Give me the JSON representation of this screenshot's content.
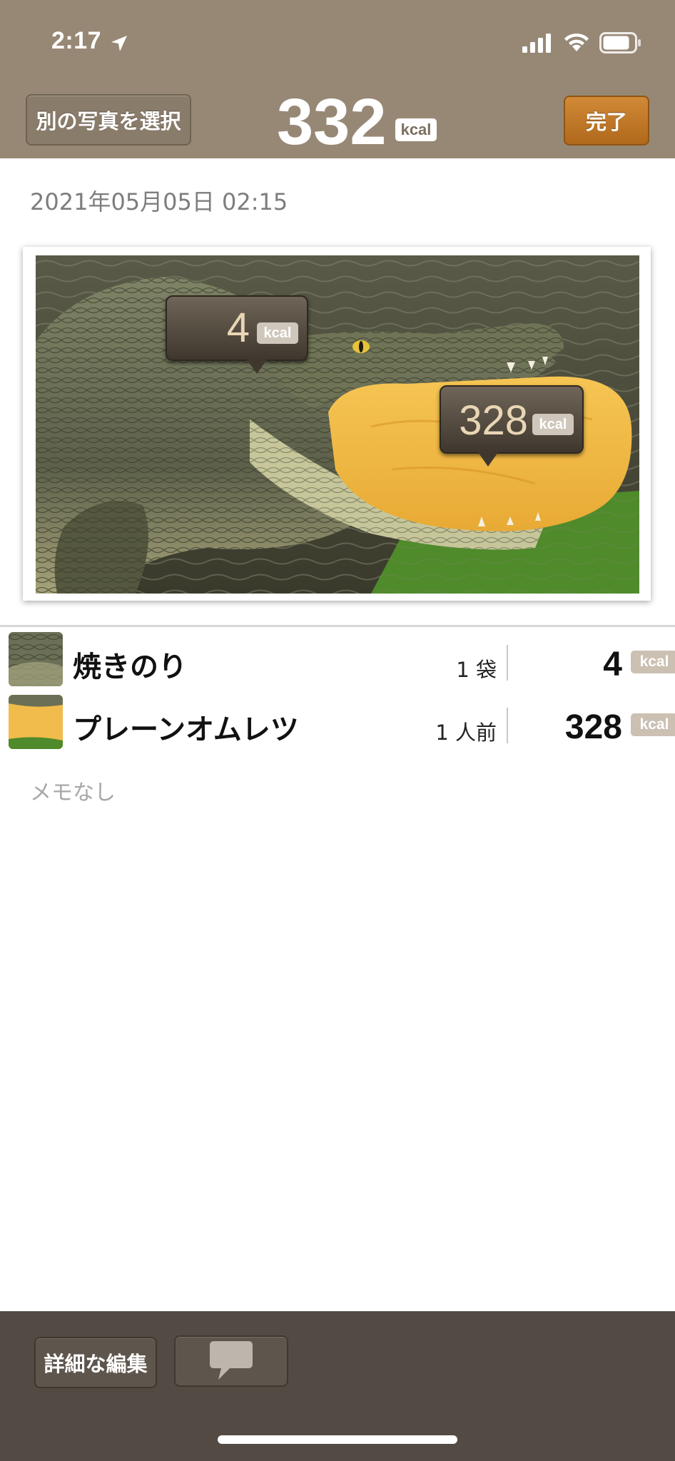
{
  "status_bar": {
    "time": "2:17"
  },
  "header": {
    "choose_photo_label": "別の写真を選択",
    "total_kcal": "332",
    "kcal_unit": "kcal",
    "done_label": "完了"
  },
  "meal": {
    "date": "2021年05月05日 02:15"
  },
  "photo": {
    "callouts": [
      {
        "value": "4",
        "unit": "kcal"
      },
      {
        "value": "328",
        "unit": "kcal"
      }
    ]
  },
  "items": [
    {
      "name": "焼きのり",
      "quantity": "1 袋",
      "kcal": "4",
      "unit": "kcal"
    },
    {
      "name": "プレーンオムレツ",
      "quantity": "1 人前",
      "kcal": "328",
      "unit": "kcal"
    }
  ],
  "memo": "メモなし",
  "toolbar": {
    "edit_label": "詳細な編集"
  },
  "colors": {
    "header_bg": "#978875",
    "done_button": "#c27a2b",
    "toolbar_bg": "#524a43"
  }
}
